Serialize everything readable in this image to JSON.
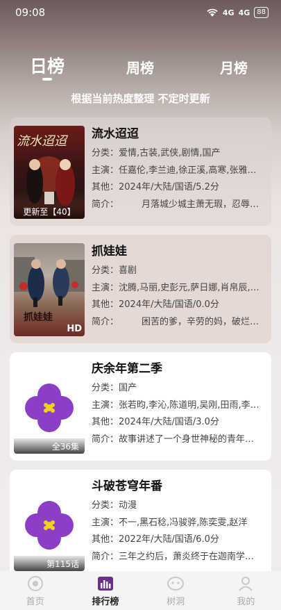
{
  "status": {
    "time": "09:08",
    "battery": "88",
    "signal1": "4G",
    "signal2": "4G"
  },
  "tabs": [
    {
      "label": "日榜",
      "active": true
    },
    {
      "label": "周榜",
      "active": false
    },
    {
      "label": "月榜",
      "active": false
    }
  ],
  "subtitle": "根据当前热度整理 不定时更新",
  "items": [
    {
      "title": "流水迢迢",
      "category": "分类：爱情,古装,武侠,剧情,国产",
      "cast": "主演：任嘉伦,李兰迪,徐正溪,高寒,张雅…",
      "other": "其他：2024年/大陆/国语/5.2分",
      "intro": "简介：        月落城少城主萧无瑕，忍辱…",
      "badge": "更新至【40】",
      "poster_text": "流水迢迢"
    },
    {
      "title": "抓娃娃",
      "category": "分类：喜剧",
      "cast": "主演：沈腾,马丽,史彭元,萨日娜,肖帛辰,…",
      "other": "其他：2024年/大陆/国语/0.0分",
      "intro": "简介：        困苦的爹，辛劳的妈，破烂…",
      "badge": "HD",
      "poster_text": "抓娃娃"
    },
    {
      "title": "庆余年第二季",
      "category": "分类：国产",
      "cast": "主演：张若昀,李沁,陈道明,吴刚,田雨,李…",
      "other": "其他：2024年/大陆/国语/3.0分",
      "intro": "简介：故事讲述了一个身世神秘的青年…",
      "badge": "全36集"
    },
    {
      "title": "斗破苍穹年番",
      "category": "分类：动漫",
      "cast": "主演：不一,黑石稔,冯骏骅,陈奕雯,赵洋",
      "other": "其他：2022年/大陆/国语/6.0分",
      "intro": "简介：三年之约后，萧炎终于在迦南学…",
      "badge": "第115话"
    }
  ],
  "tabbar": [
    {
      "label": "首页",
      "icon": "home-icon",
      "active": false
    },
    {
      "label": "排行榜",
      "icon": "rank-icon",
      "active": true
    },
    {
      "label": "树洞",
      "icon": "treehole-icon",
      "active": false
    },
    {
      "label": "我的",
      "icon": "profile-icon",
      "active": false
    }
  ],
  "colors": {
    "flower": "#8a3fc6",
    "flower_center": "#f2d21b",
    "accent": "#111111"
  }
}
